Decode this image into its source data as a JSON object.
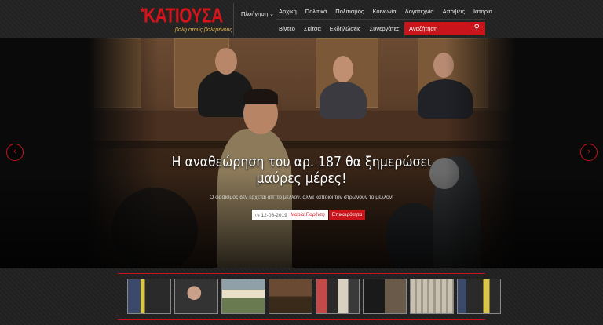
{
  "site": {
    "logo_text": "ΚΑΤΙΟΥΣΑ",
    "logo_tagline": "...βολή στους βολεμένους",
    "accent": "#c8141a"
  },
  "nav": {
    "navigation_label": "Πλοήγηση",
    "row1": [
      "Αρχική",
      "Πολιτικά",
      "Πολιτισμός",
      "Κοινωνία",
      "Λογοτεχνία",
      "Απόψεις",
      "Ιστορία"
    ],
    "row2": [
      "Βίντεο",
      "Σκίτσα",
      "Εκδηλώσεις",
      "Συνεργάτες"
    ],
    "search_placeholder": "Αναζήτηση"
  },
  "hero": {
    "headline": "Η αναθεώρηση του αρ. 187 θα ξημερώσει μαύρες μέρες!",
    "subline": "Ο φασισμός δεν έρχεται απ' το μέλλον, αλλά κάποιοι τον στρώνουν το μέλλον!",
    "date": "12-03-2019",
    "author": "Μαρία Παρέντη",
    "category": "Επικαιρότητα"
  },
  "thumbnails_count_label": ""
}
